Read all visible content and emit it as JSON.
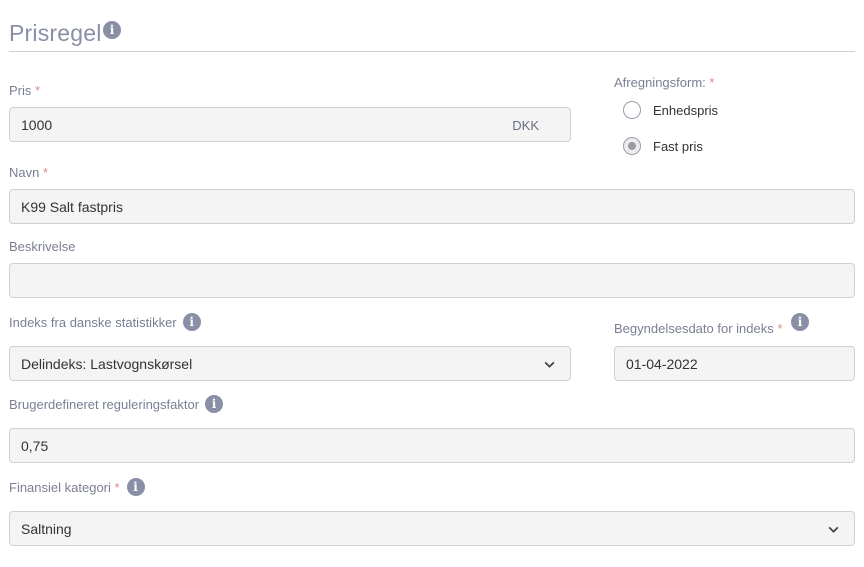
{
  "section": {
    "title": "Prisregel"
  },
  "price": {
    "label": "Pris",
    "required_mark": "*",
    "value": "1000",
    "currency": "DKK"
  },
  "settlement": {
    "label": "Afregningsform:",
    "required_mark": "*",
    "options": [
      {
        "label": "Enhedspris",
        "selected": false
      },
      {
        "label": "Fast pris",
        "selected": true
      }
    ]
  },
  "name": {
    "label": "Navn",
    "required_mark": "*",
    "value": "K99 Salt fastpris"
  },
  "description": {
    "label": "Beskrivelse",
    "value": ""
  },
  "index": {
    "label": "Indeks fra danske statistikker",
    "selected": "Delindeks: Lastvognskørsel"
  },
  "start_date": {
    "label": "Begyndelsesdato for indeks",
    "required_mark": "*",
    "value": "01-04-2022"
  },
  "custom_factor": {
    "label": "Brugerdefineret reguleringsfaktor",
    "value": "0,75"
  },
  "financial_category": {
    "label": "Finansiel kategori",
    "required_mark": "*",
    "selected": "Saltning"
  },
  "colors": {
    "accent": "#8a8fa8",
    "required": "#e08a8a",
    "field_bg": "#f4f4f4",
    "border": "#cfd0d6"
  },
  "icons": {
    "info": "info-icon",
    "dropdown": "chevron-down-icon"
  }
}
